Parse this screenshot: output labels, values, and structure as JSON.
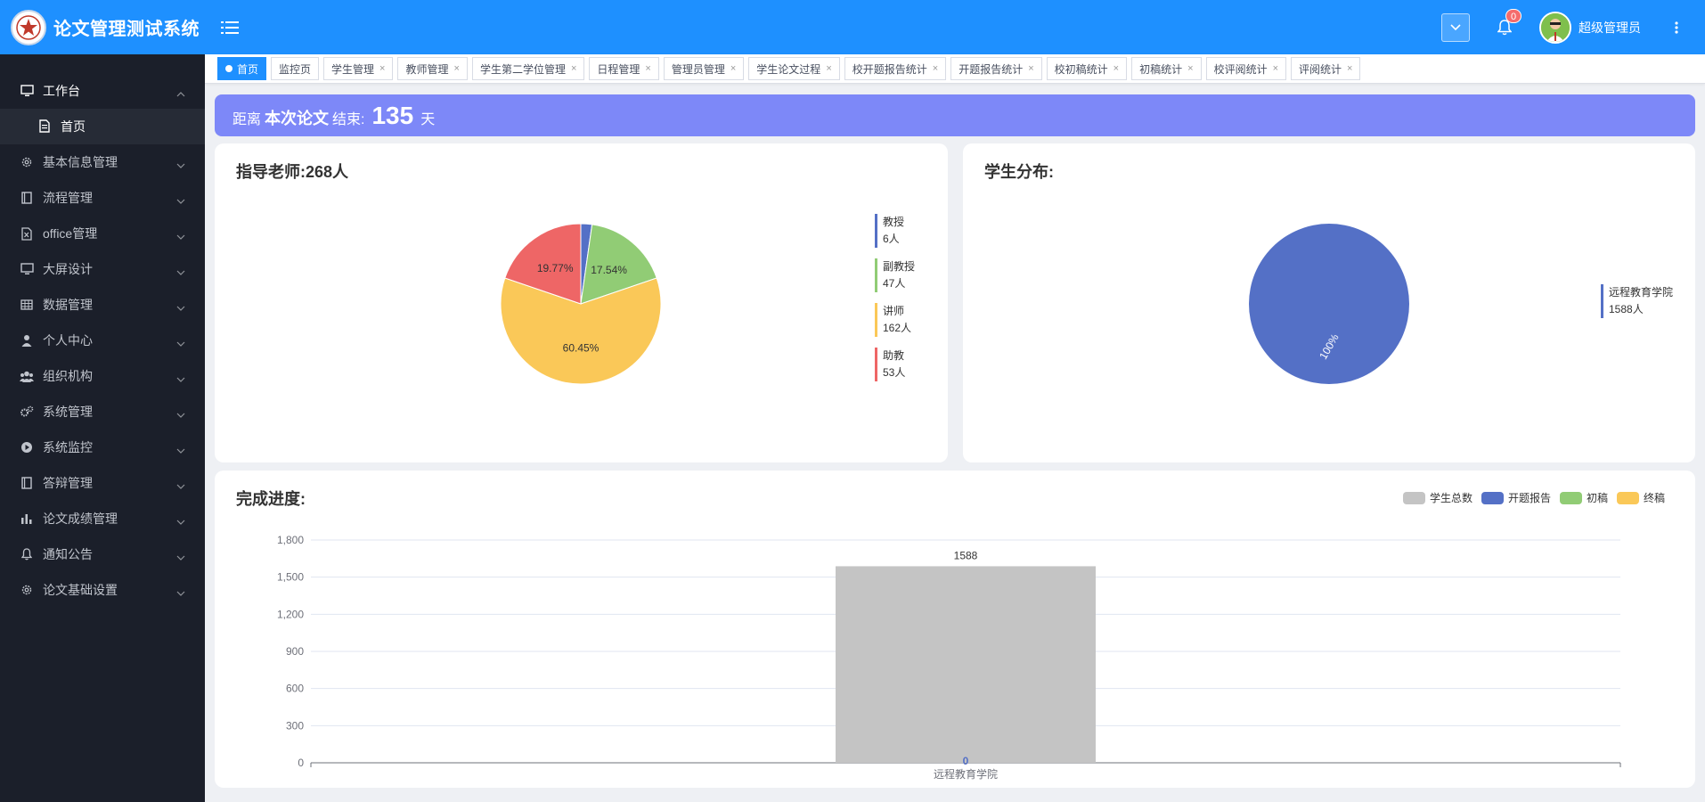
{
  "header": {
    "app_title": "论文管理测试系统",
    "notification_count": "0",
    "username": "超级管理员"
  },
  "sidebar": {
    "items": [
      {
        "label": "工作台",
        "icon": "monitor-icon",
        "open": true,
        "children": [
          {
            "label": "首页",
            "icon": "document-icon"
          }
        ]
      },
      {
        "label": "基本信息管理",
        "icon": "gear-icon"
      },
      {
        "label": "流程管理",
        "icon": "book-icon"
      },
      {
        "label": "office管理",
        "icon": "excel-file-icon"
      },
      {
        "label": "大屏设计",
        "icon": "monitor-icon"
      },
      {
        "label": "数据管理",
        "icon": "table-icon"
      },
      {
        "label": "个人中心",
        "icon": "user-icon"
      },
      {
        "label": "组织机构",
        "icon": "users-icon"
      },
      {
        "label": "系统管理",
        "icon": "gears-icon"
      },
      {
        "label": "系统监控",
        "icon": "play-circle-icon"
      },
      {
        "label": "答辩管理",
        "icon": "book-icon"
      },
      {
        "label": "论文成绩管理",
        "icon": "bar-chart-icon"
      },
      {
        "label": "通知公告",
        "icon": "bell-icon"
      },
      {
        "label": "论文基础设置",
        "icon": "gear-icon"
      }
    ]
  },
  "tabs": [
    {
      "label": "首页",
      "active": true
    },
    {
      "label": "监控页"
    },
    {
      "label": "学生管理",
      "closable": true
    },
    {
      "label": "教师管理",
      "closable": true
    },
    {
      "label": "学生第二学位管理",
      "closable": true
    },
    {
      "label": "日程管理",
      "closable": true
    },
    {
      "label": "管理员管理",
      "closable": true
    },
    {
      "label": "学生论文过程",
      "closable": true
    },
    {
      "label": "校开题报告统计",
      "closable": true
    },
    {
      "label": "开题报告统计",
      "closable": true
    },
    {
      "label": "校初稿统计",
      "closable": true
    },
    {
      "label": "初稿统计",
      "closable": true
    },
    {
      "label": "校评阅统计",
      "closable": true
    },
    {
      "label": "评阅统计",
      "closable": true
    }
  ],
  "banner": {
    "prefix": "距离",
    "bold": "本次论文",
    "suffix": "结束:",
    "days": "135",
    "unit": "天"
  },
  "close_glyph": "×",
  "colors": {
    "primary": "#1e90ff",
    "banner": "#7d88f8",
    "blue": "#5470c6",
    "green": "#91cc75",
    "yellow": "#fac858",
    "red": "#ee6666",
    "gray": "#c4c4c4"
  },
  "chart_data": [
    {
      "type": "pie",
      "title": "指导老师:268人",
      "slices": [
        {
          "name": "教授",
          "value": 6,
          "legend_value": "6人",
          "color": "#5470c6",
          "label": ""
        },
        {
          "name": "副教授",
          "value": 47,
          "legend_value": "47人",
          "color": "#91cc75",
          "label": "17.54%"
        },
        {
          "name": "讲师",
          "value": 162,
          "legend_value": "162人",
          "color": "#fac858",
          "label": "60.45%"
        },
        {
          "name": "助教",
          "value": 53,
          "legend_value": "53人",
          "color": "#ee6666",
          "label": "19.77%"
        }
      ],
      "legend_position": "right"
    },
    {
      "type": "pie",
      "title": "学生分布:",
      "slices": [
        {
          "name": "远程教育学院",
          "value": 1588,
          "legend_value": "1588人",
          "color": "#5470c6",
          "label": "100%"
        }
      ],
      "legend_position": "right"
    },
    {
      "type": "bar",
      "title": "完成进度:",
      "categories": [
        "远程教育学院"
      ],
      "series": [
        {
          "name": "学生总数",
          "values": [
            1588
          ],
          "color": "#c4c4c4",
          "label": "1588"
        },
        {
          "name": "开题报告",
          "values": [
            0
          ],
          "color": "#5470c6",
          "label": "0"
        },
        {
          "name": "初稿",
          "values": [
            0
          ],
          "color": "#91cc75"
        },
        {
          "name": "终稿",
          "values": [
            0
          ],
          "color": "#fac858"
        }
      ],
      "ylim": [
        0,
        1800
      ],
      "yticks": [
        "0",
        "300",
        "600",
        "900",
        "1,200",
        "1,500",
        "1,800"
      ],
      "grid": true,
      "legend_position": "top-right"
    }
  ]
}
